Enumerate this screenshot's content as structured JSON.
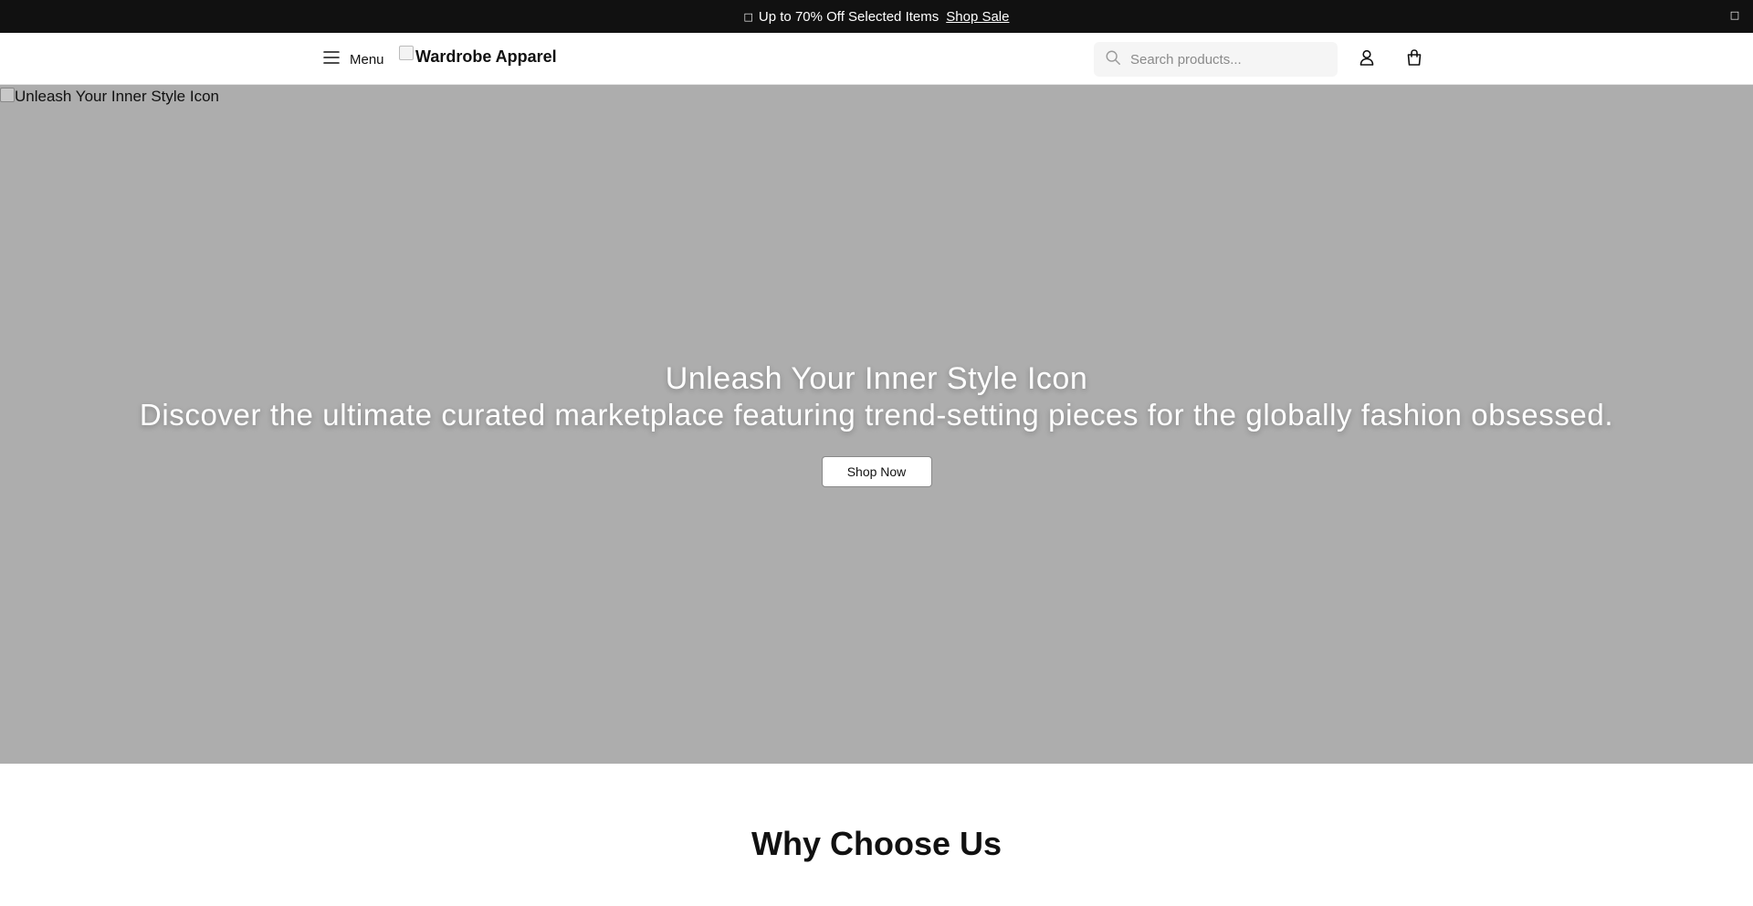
{
  "announcement": {
    "glyph": "□",
    "text": "Up to 70% Off Selected Items",
    "link_label": "Shop Sale",
    "close_glyph": "□"
  },
  "header": {
    "menu_label": "Menu",
    "logo_text": "Wardrobe Apparel",
    "search_placeholder": "Search products...",
    "search_value": "",
    "icons": [
      "menu-icon",
      "search-icon",
      "account-icon",
      "shopping-bag-icon"
    ]
  },
  "hero": {
    "image_alt": "Unleash Your Inner Style Icon",
    "title": "Unleash Your Inner Style Icon",
    "subtitle": "Discover the ultimate curated marketplace featuring trend-setting pieces for the globally fashion obsessed.",
    "cta_label": "Shop Now",
    "background_color": "#adadad"
  },
  "section": {
    "heading": "Why Choose Us"
  },
  "colors": {
    "announcement_bg": "#111111",
    "accent_text": "#111111",
    "search_bg": "#f5f5f5"
  }
}
